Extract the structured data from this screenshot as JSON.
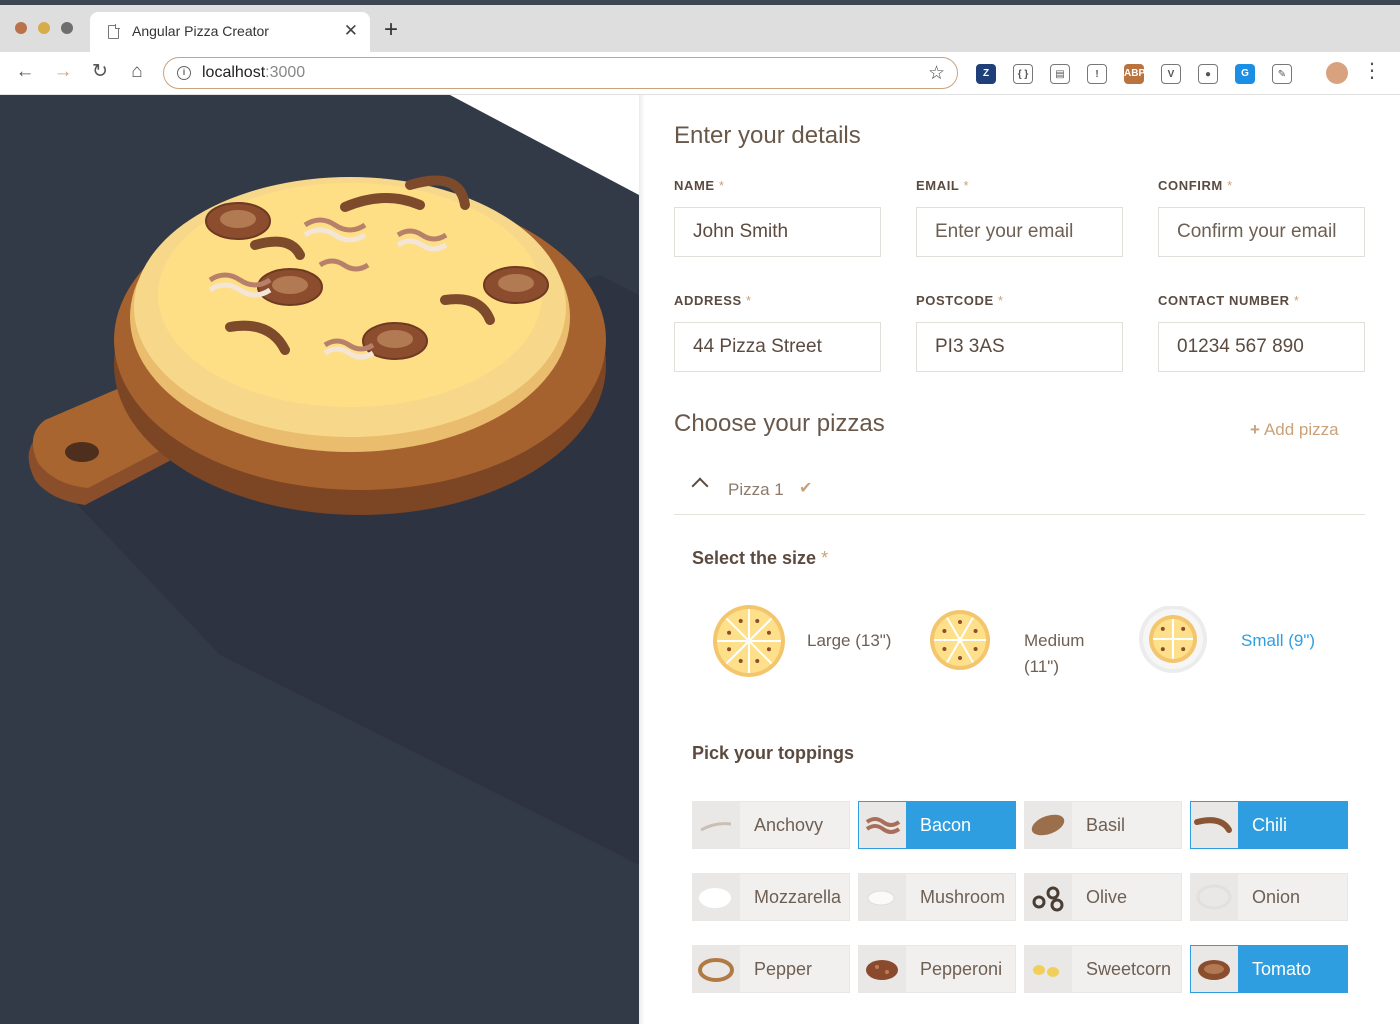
{
  "browser": {
    "tab_title": "Angular Pizza Creator",
    "tab_close": "✕",
    "new_tab": "+",
    "url_host": "localhost",
    "url_port": ":3000",
    "extensions": [
      {
        "name": "zotero",
        "label": "Z",
        "color": "#1e3f78"
      },
      {
        "name": "json-viewer",
        "label": "{ }",
        "color": "#ffffff"
      },
      {
        "name": "clipper",
        "label": "▤",
        "color": "#ffffff"
      },
      {
        "name": "onepassword",
        "label": "!",
        "color": "#ffffff"
      },
      {
        "name": "adblock-plus",
        "label": "ABP",
        "color": "#b8733e"
      },
      {
        "name": "vue-devtools",
        "label": "V",
        "color": "#ffffff"
      },
      {
        "name": "octotree",
        "label": "●",
        "color": "#ffffff"
      },
      {
        "name": "grammarly",
        "label": "G",
        "color": "#1a8fe3"
      },
      {
        "name": "feather",
        "label": "✎",
        "color": "#ffffff"
      }
    ]
  },
  "details": {
    "title": "Enter your details",
    "fields": [
      {
        "label": "NAME",
        "value": "John Smith",
        "placeholder": ""
      },
      {
        "label": "EMAIL",
        "value": "",
        "placeholder": "Enter your email"
      },
      {
        "label": "CONFIRM",
        "value": "",
        "placeholder": "Confirm your email"
      },
      {
        "label": "ADDRESS",
        "value": "44 Pizza Street",
        "placeholder": ""
      },
      {
        "label": "POSTCODE",
        "value": "PI3 3AS",
        "placeholder": ""
      },
      {
        "label": "CONTACT NUMBER",
        "value": "01234 567 890",
        "placeholder": ""
      }
    ],
    "required_marker": "*"
  },
  "pizzas": {
    "title": "Choose your pizzas",
    "add_label": "Add pizza",
    "add_icon": "+",
    "items": [
      {
        "name": "Pizza 1",
        "check": "✔"
      }
    ]
  },
  "size": {
    "title": "Select the size",
    "options": [
      {
        "label": "Large (13\")",
        "selected": false
      },
      {
        "label": "Medium (11\")",
        "selected": false
      },
      {
        "label": "Small (9\")",
        "selected": true
      }
    ]
  },
  "toppings": {
    "title": "Pick your toppings",
    "items": [
      {
        "label": "Anchovy",
        "selected": false
      },
      {
        "label": "Bacon",
        "selected": true
      },
      {
        "label": "Basil",
        "selected": false
      },
      {
        "label": "Chili",
        "selected": true
      },
      {
        "label": "Mozzarella",
        "selected": false
      },
      {
        "label": "Mushroom",
        "selected": false
      },
      {
        "label": "Olive",
        "selected": false
      },
      {
        "label": "Onion",
        "selected": false
      },
      {
        "label": "Pepper",
        "selected": false
      },
      {
        "label": "Pepperoni",
        "selected": false
      },
      {
        "label": "Sweetcorn",
        "selected": false
      },
      {
        "label": "Tomato",
        "selected": true
      }
    ]
  },
  "colors": {
    "accent_blue": "#2e9ee0",
    "accent_gold": "#c9a27a",
    "text_brown": "#5b4a3f",
    "panel_dark": "#333a47"
  }
}
